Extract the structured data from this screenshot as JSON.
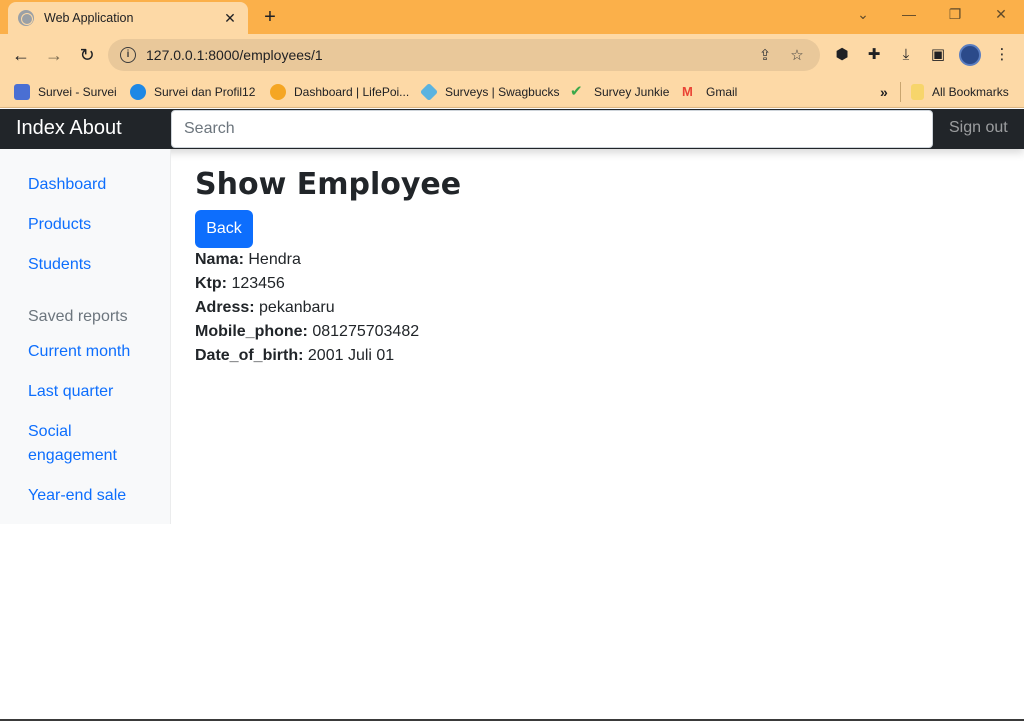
{
  "browser": {
    "tab_title": "Web Application",
    "url": "127.0.0.1:8000/employees/1",
    "bookmarks": [
      {
        "label": "Survei - Survei",
        "color": "#4a6fd3"
      },
      {
        "label": "Survei dan Profil12",
        "color": "#1e88e5"
      },
      {
        "label": "Dashboard | LifePoi...",
        "color": "#f5a623"
      },
      {
        "label": "Surveys | Swagbucks",
        "color": "#5ab3e0"
      },
      {
        "label": "Survey Junkie",
        "color": "#3aa84a"
      },
      {
        "label": "Gmail",
        "color": "#ea4335"
      }
    ],
    "all_bookmarks_label": "All Bookmarks"
  },
  "navbar": {
    "brand": "Index About",
    "search_placeholder": "Search",
    "signout": "Sign out"
  },
  "sidebar": {
    "items": [
      "Dashboard",
      "Products",
      "Students"
    ],
    "saved_reports_heading": "Saved reports",
    "reports": [
      "Current month",
      "Last quarter",
      "Social engagement",
      "Year-end sale"
    ]
  },
  "main": {
    "title": "Show Employee",
    "back_label": "Back",
    "fields": [
      {
        "label": "Nama:",
        "value": "Hendra"
      },
      {
        "label": "Ktp:",
        "value": "123456"
      },
      {
        "label": "Adress:",
        "value": "pekanbaru"
      },
      {
        "label": "Mobile_phone:",
        "value": "081275703482"
      },
      {
        "label": "Date_of_birth:",
        "value": "2001 Juli 01"
      }
    ]
  },
  "colors": {
    "accent": "#0d6efd",
    "navbar_bg": "#212529",
    "browser_frame": "#fbb04a"
  }
}
